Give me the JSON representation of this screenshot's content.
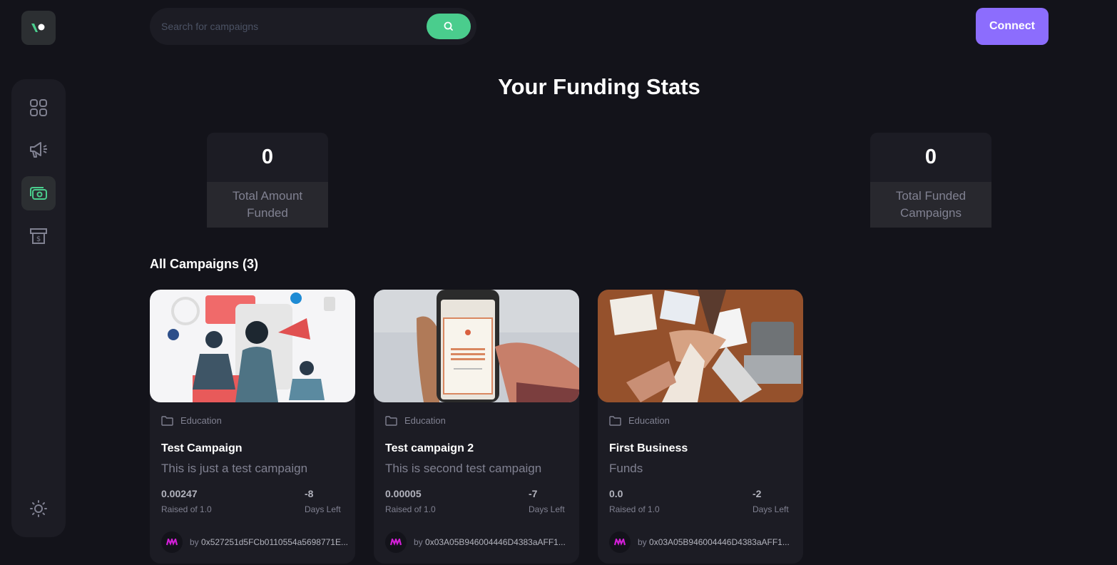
{
  "search": {
    "placeholder": "Search for campaigns"
  },
  "header": {
    "connect_label": "Connect"
  },
  "page": {
    "title": "Your Funding Stats"
  },
  "stats": [
    {
      "value": "0",
      "label": "Total Amount Funded"
    },
    {
      "value": "0",
      "label": "Total Funded Campaigns"
    }
  ],
  "campaigns_section": {
    "title": "All Campaigns (3)"
  },
  "campaigns": [
    {
      "category": "Education",
      "title": "Test Campaign",
      "description": "This is just a test campaign",
      "raised": "0.00247",
      "raised_label": "Raised of 1.0",
      "days_left": "-8",
      "days_label": "Days Left",
      "owner": "0x527251d5FCb0110554a5698771E..."
    },
    {
      "category": "Education",
      "title": "Test campaign 2",
      "description": "This is second test campaign",
      "raised": "0.00005",
      "raised_label": "Raised of 1.0",
      "days_left": "-7",
      "days_label": "Days Left",
      "owner": "0x03A05B946004446D4383aAFF1..."
    },
    {
      "category": "Education",
      "title": "First Business",
      "description": "Funds",
      "raised": "0.0",
      "raised_label": "Raised of 1.0",
      "days_left": "-2",
      "days_label": "Days Left",
      "owner": "0x03A05B946004446D4383aAFF1..."
    }
  ],
  "by_prefix": "by",
  "colors": {
    "accent_green": "#4acd8d",
    "accent_purple": "#8c6dfd",
    "background": "#13131a",
    "surface": "#1c1c24"
  },
  "icons": [
    "logo-icon",
    "dashboard-icon",
    "campaign-icon",
    "payment-icon",
    "withdraw-icon",
    "sun-icon",
    "search-icon",
    "folder-icon",
    "avatar-icon"
  ]
}
